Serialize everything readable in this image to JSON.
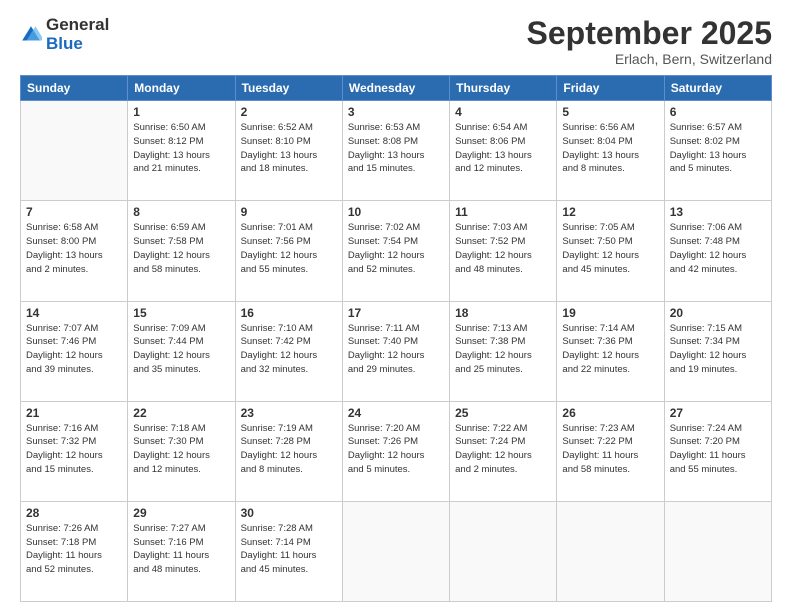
{
  "logo": {
    "general": "General",
    "blue": "Blue"
  },
  "header": {
    "month": "September 2025",
    "location": "Erlach, Bern, Switzerland"
  },
  "days_of_week": [
    "Sunday",
    "Monday",
    "Tuesday",
    "Wednesday",
    "Thursday",
    "Friday",
    "Saturday"
  ],
  "weeks": [
    [
      {
        "day": "",
        "info": ""
      },
      {
        "day": "1",
        "info": "Sunrise: 6:50 AM\nSunset: 8:12 PM\nDaylight: 13 hours\nand 21 minutes."
      },
      {
        "day": "2",
        "info": "Sunrise: 6:52 AM\nSunset: 8:10 PM\nDaylight: 13 hours\nand 18 minutes."
      },
      {
        "day": "3",
        "info": "Sunrise: 6:53 AM\nSunset: 8:08 PM\nDaylight: 13 hours\nand 15 minutes."
      },
      {
        "day": "4",
        "info": "Sunrise: 6:54 AM\nSunset: 8:06 PM\nDaylight: 13 hours\nand 12 minutes."
      },
      {
        "day": "5",
        "info": "Sunrise: 6:56 AM\nSunset: 8:04 PM\nDaylight: 13 hours\nand 8 minutes."
      },
      {
        "day": "6",
        "info": "Sunrise: 6:57 AM\nSunset: 8:02 PM\nDaylight: 13 hours\nand 5 minutes."
      }
    ],
    [
      {
        "day": "7",
        "info": "Sunrise: 6:58 AM\nSunset: 8:00 PM\nDaylight: 13 hours\nand 2 minutes."
      },
      {
        "day": "8",
        "info": "Sunrise: 6:59 AM\nSunset: 7:58 PM\nDaylight: 12 hours\nand 58 minutes."
      },
      {
        "day": "9",
        "info": "Sunrise: 7:01 AM\nSunset: 7:56 PM\nDaylight: 12 hours\nand 55 minutes."
      },
      {
        "day": "10",
        "info": "Sunrise: 7:02 AM\nSunset: 7:54 PM\nDaylight: 12 hours\nand 52 minutes."
      },
      {
        "day": "11",
        "info": "Sunrise: 7:03 AM\nSunset: 7:52 PM\nDaylight: 12 hours\nand 48 minutes."
      },
      {
        "day": "12",
        "info": "Sunrise: 7:05 AM\nSunset: 7:50 PM\nDaylight: 12 hours\nand 45 minutes."
      },
      {
        "day": "13",
        "info": "Sunrise: 7:06 AM\nSunset: 7:48 PM\nDaylight: 12 hours\nand 42 minutes."
      }
    ],
    [
      {
        "day": "14",
        "info": "Sunrise: 7:07 AM\nSunset: 7:46 PM\nDaylight: 12 hours\nand 39 minutes."
      },
      {
        "day": "15",
        "info": "Sunrise: 7:09 AM\nSunset: 7:44 PM\nDaylight: 12 hours\nand 35 minutes."
      },
      {
        "day": "16",
        "info": "Sunrise: 7:10 AM\nSunset: 7:42 PM\nDaylight: 12 hours\nand 32 minutes."
      },
      {
        "day": "17",
        "info": "Sunrise: 7:11 AM\nSunset: 7:40 PM\nDaylight: 12 hours\nand 29 minutes."
      },
      {
        "day": "18",
        "info": "Sunrise: 7:13 AM\nSunset: 7:38 PM\nDaylight: 12 hours\nand 25 minutes."
      },
      {
        "day": "19",
        "info": "Sunrise: 7:14 AM\nSunset: 7:36 PM\nDaylight: 12 hours\nand 22 minutes."
      },
      {
        "day": "20",
        "info": "Sunrise: 7:15 AM\nSunset: 7:34 PM\nDaylight: 12 hours\nand 19 minutes."
      }
    ],
    [
      {
        "day": "21",
        "info": "Sunrise: 7:16 AM\nSunset: 7:32 PM\nDaylight: 12 hours\nand 15 minutes."
      },
      {
        "day": "22",
        "info": "Sunrise: 7:18 AM\nSunset: 7:30 PM\nDaylight: 12 hours\nand 12 minutes."
      },
      {
        "day": "23",
        "info": "Sunrise: 7:19 AM\nSunset: 7:28 PM\nDaylight: 12 hours\nand 8 minutes."
      },
      {
        "day": "24",
        "info": "Sunrise: 7:20 AM\nSunset: 7:26 PM\nDaylight: 12 hours\nand 5 minutes."
      },
      {
        "day": "25",
        "info": "Sunrise: 7:22 AM\nSunset: 7:24 PM\nDaylight: 12 hours\nand 2 minutes."
      },
      {
        "day": "26",
        "info": "Sunrise: 7:23 AM\nSunset: 7:22 PM\nDaylight: 11 hours\nand 58 minutes."
      },
      {
        "day": "27",
        "info": "Sunrise: 7:24 AM\nSunset: 7:20 PM\nDaylight: 11 hours\nand 55 minutes."
      }
    ],
    [
      {
        "day": "28",
        "info": "Sunrise: 7:26 AM\nSunset: 7:18 PM\nDaylight: 11 hours\nand 52 minutes."
      },
      {
        "day": "29",
        "info": "Sunrise: 7:27 AM\nSunset: 7:16 PM\nDaylight: 11 hours\nand 48 minutes."
      },
      {
        "day": "30",
        "info": "Sunrise: 7:28 AM\nSunset: 7:14 PM\nDaylight: 11 hours\nand 45 minutes."
      },
      {
        "day": "",
        "info": ""
      },
      {
        "day": "",
        "info": ""
      },
      {
        "day": "",
        "info": ""
      },
      {
        "day": "",
        "info": ""
      }
    ]
  ]
}
